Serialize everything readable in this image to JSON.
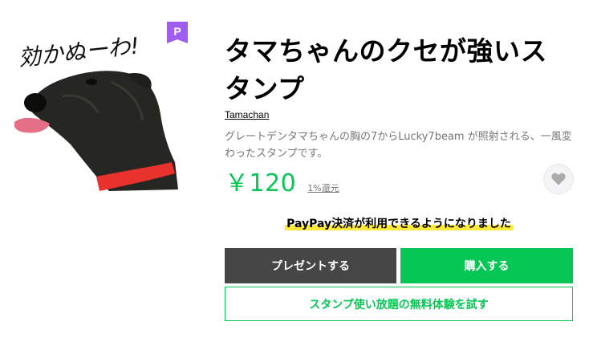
{
  "sticker": {
    "caption": "効かぬーわ!",
    "icon": "dog-sticker-image"
  },
  "badge": {
    "label": "P",
    "color": "#9e5cf0"
  },
  "product": {
    "title": "タマちゃんのクセが強いスタンプ",
    "author": "Tamachan",
    "description": "グレートデンタマちゃんの胸の7からLucky7beam が照射される、一風変わったスタンプです。",
    "price": "￥120",
    "points": "1%還元"
  },
  "favorite": {
    "icon": "heart-icon"
  },
  "notice": {
    "paypay": "PayPay決済が利用できるようになりました"
  },
  "actions": {
    "gift_label": "プレゼントする",
    "buy_label": "購入する",
    "trial_label": "スタンプ使い放題の無料体験を試す"
  },
  "colors": {
    "accent": "#06c755",
    "gift_button": "#464646",
    "highlight": "#ffe93a",
    "collar": "#e8322d"
  }
}
